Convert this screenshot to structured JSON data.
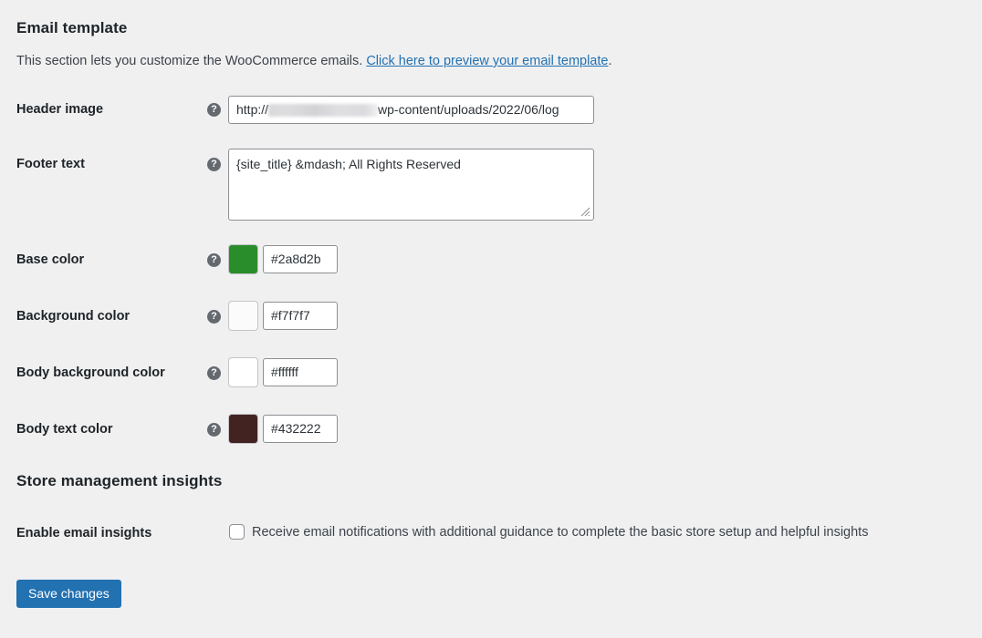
{
  "email_template": {
    "title": "Email template",
    "description_before": "This section lets you customize the WooCommerce emails. ",
    "description_link": "Click here to preview your email template",
    "description_after": ".",
    "help_icon_glyph": "?",
    "fields": {
      "header_image": {
        "label": "Header image",
        "url_prefix": "http://",
        "url_redacted": "",
        "url_suffix": "wp-content/uploads/2022/06/log"
      },
      "footer_text": {
        "label": "Footer text",
        "value": "{site_title} &mdash; All Rights Reserved"
      },
      "base_color": {
        "label": "Base color",
        "hex": "#2a8d2b",
        "swatch": "#2a8d2b"
      },
      "background_color": {
        "label": "Background color",
        "hex": "#f7f7f7",
        "swatch": "#fbfbfb"
      },
      "body_background_color": {
        "label": "Body background color",
        "hex": "#ffffff",
        "swatch": "#ffffff"
      },
      "body_text_color": {
        "label": "Body text color",
        "hex": "#432222",
        "swatch": "#432222"
      }
    }
  },
  "store_insights": {
    "title": "Store management insights",
    "field": {
      "label": "Enable email insights",
      "checkbox_label": "Receive email notifications with additional guidance to complete the basic store setup and helpful insights",
      "checked": false
    }
  },
  "actions": {
    "save_label": "Save changes"
  },
  "theme": {
    "page_background": "#f0f0f1",
    "link_color": "#2271b1",
    "primary_button": "#2271b1",
    "label_color": "#1d2327",
    "text_color": "#3c434a",
    "input_border": "#8c8f94",
    "help_icon_background": "#646970"
  }
}
